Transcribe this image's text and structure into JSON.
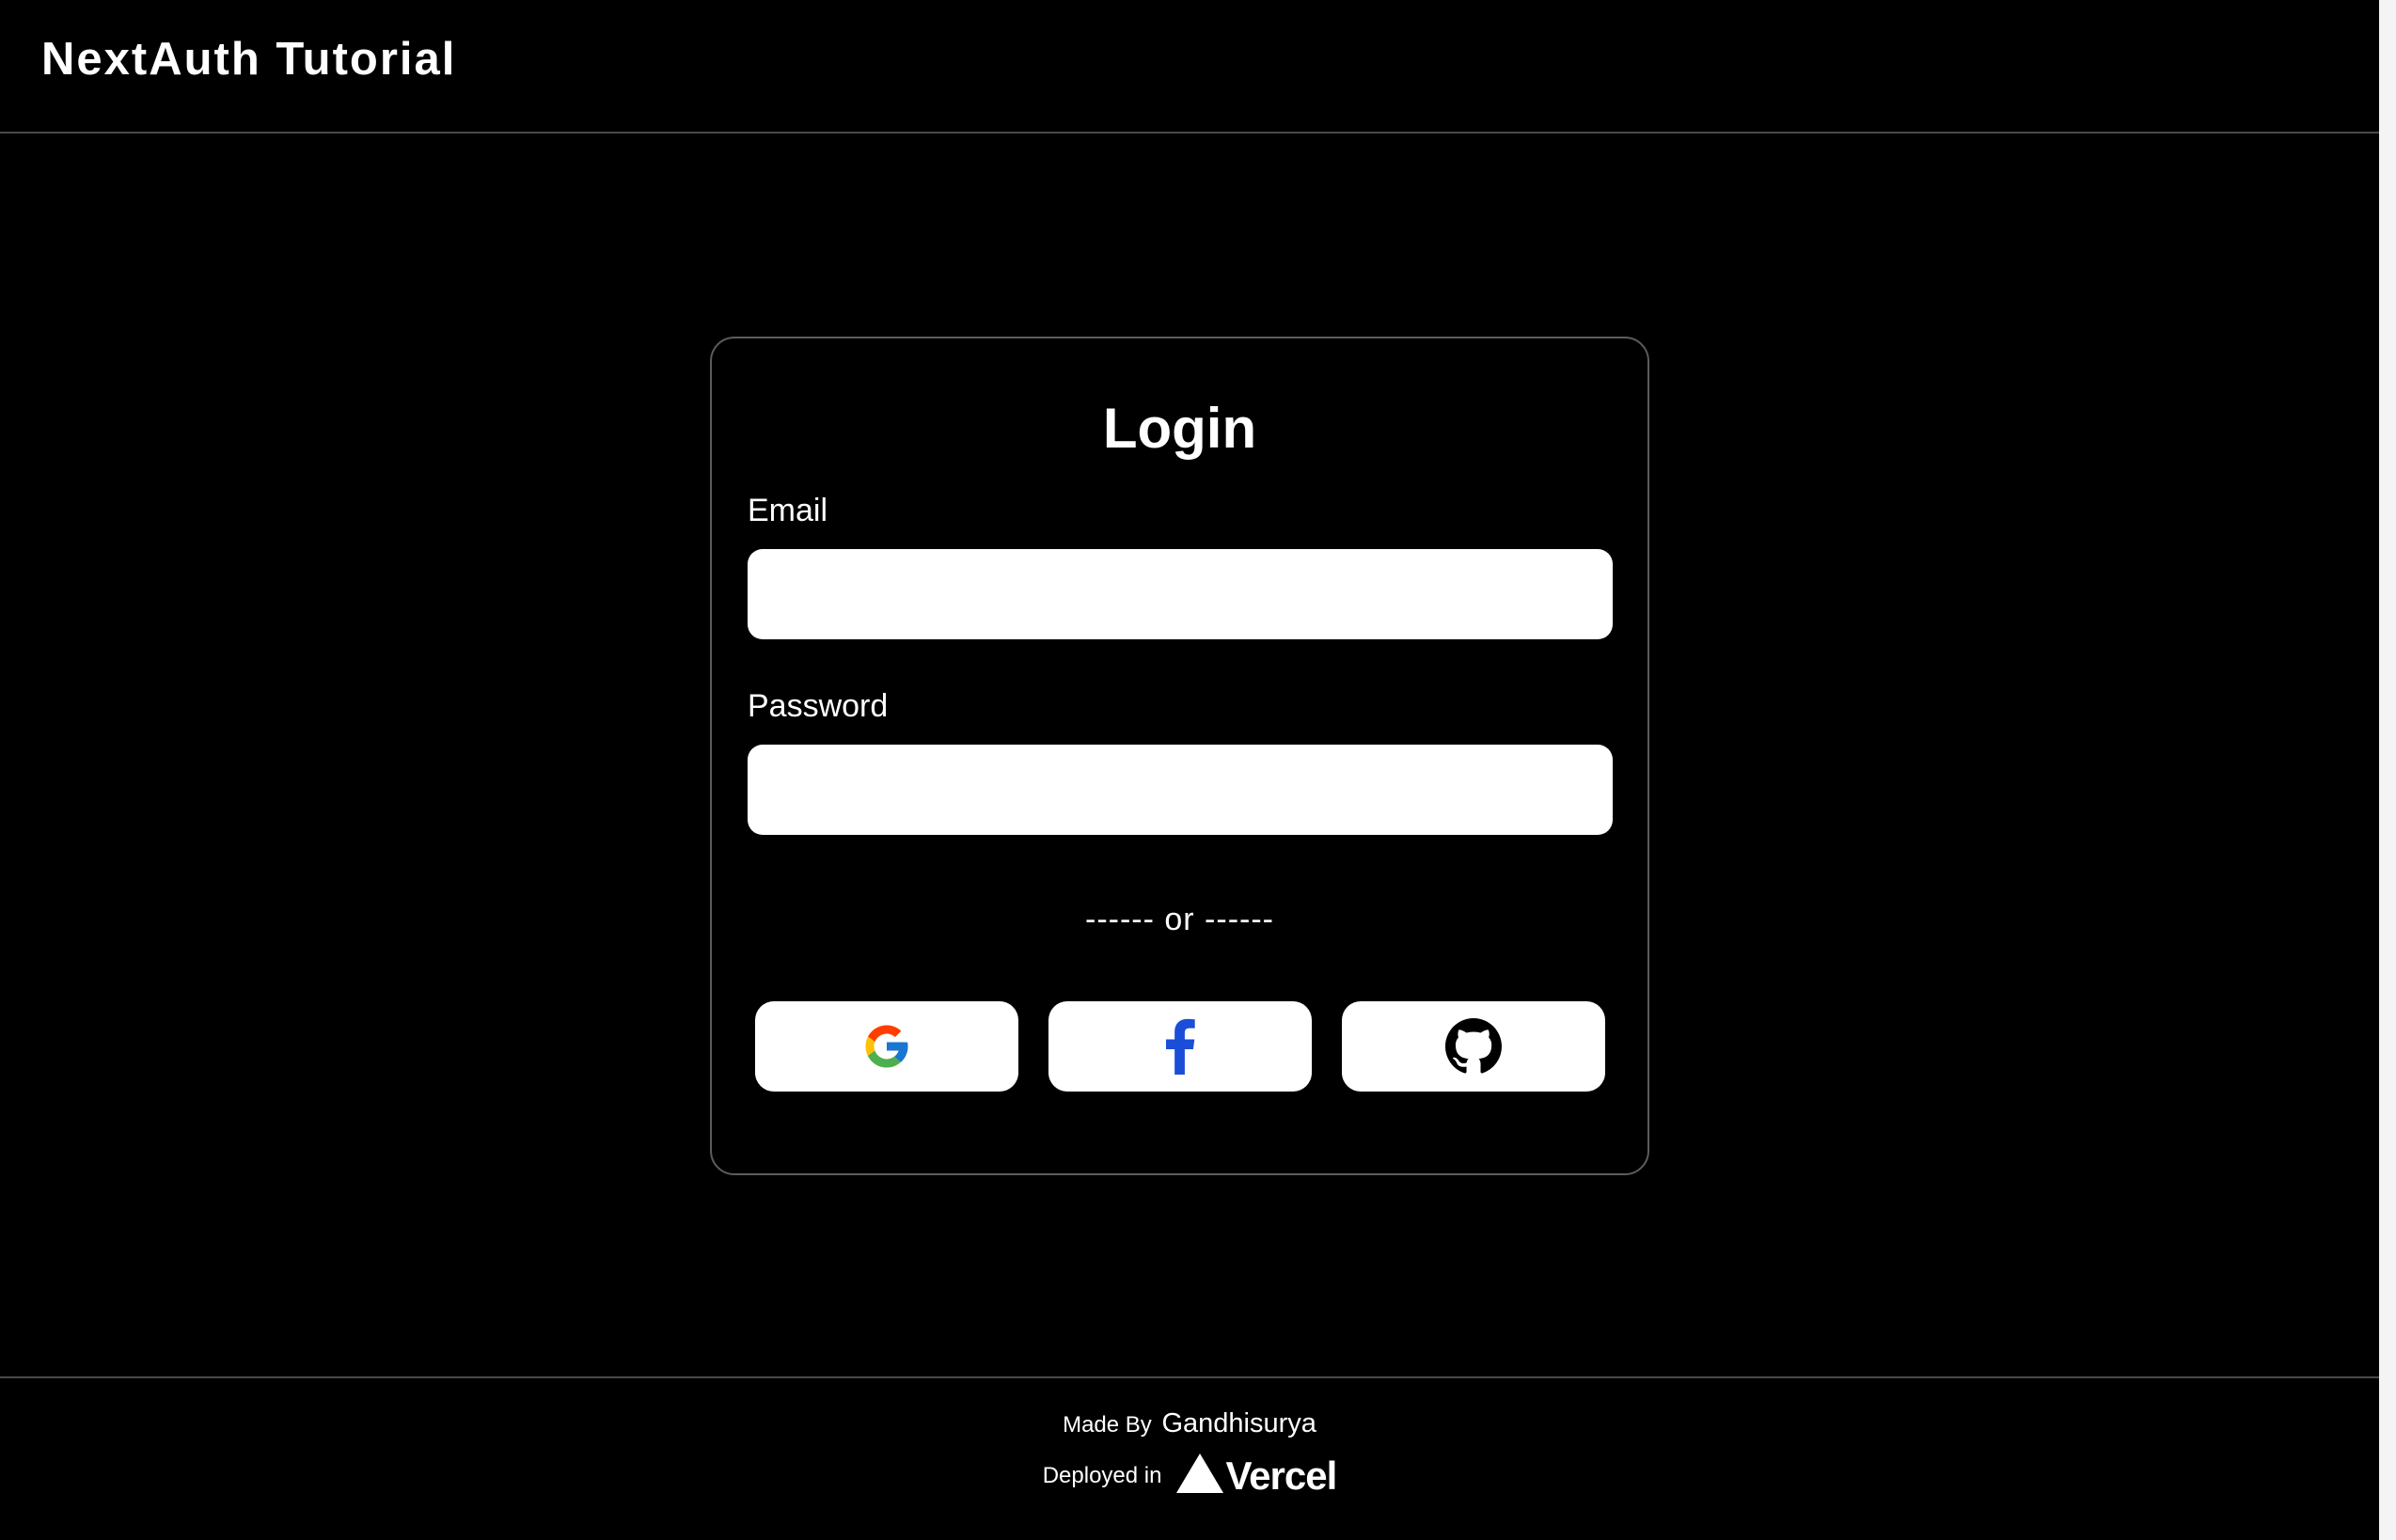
{
  "header": {
    "title": "NextAuth Tutorial"
  },
  "login": {
    "title": "Login",
    "email_label": "Email",
    "email_value": "",
    "password_label": "Password",
    "password_value": "",
    "separator": "------ or ------",
    "providers": [
      {
        "name": "Google",
        "icon": "google-icon"
      },
      {
        "name": "Facebook",
        "icon": "facebook-icon",
        "color": "#1a4ed8"
      },
      {
        "name": "GitHub",
        "icon": "github-icon",
        "color": "#000000"
      }
    ]
  },
  "footer": {
    "made_by_label": "Made By",
    "author": "Gandhisurya",
    "deployed_label": "Deployed in",
    "platform": "Vercel",
    "platform_icon": "vercel-triangle-icon"
  },
  "colors": {
    "background": "#000000",
    "text": "#ffffff",
    "border": "#5c5c5c",
    "input_bg": "#ffffff"
  }
}
